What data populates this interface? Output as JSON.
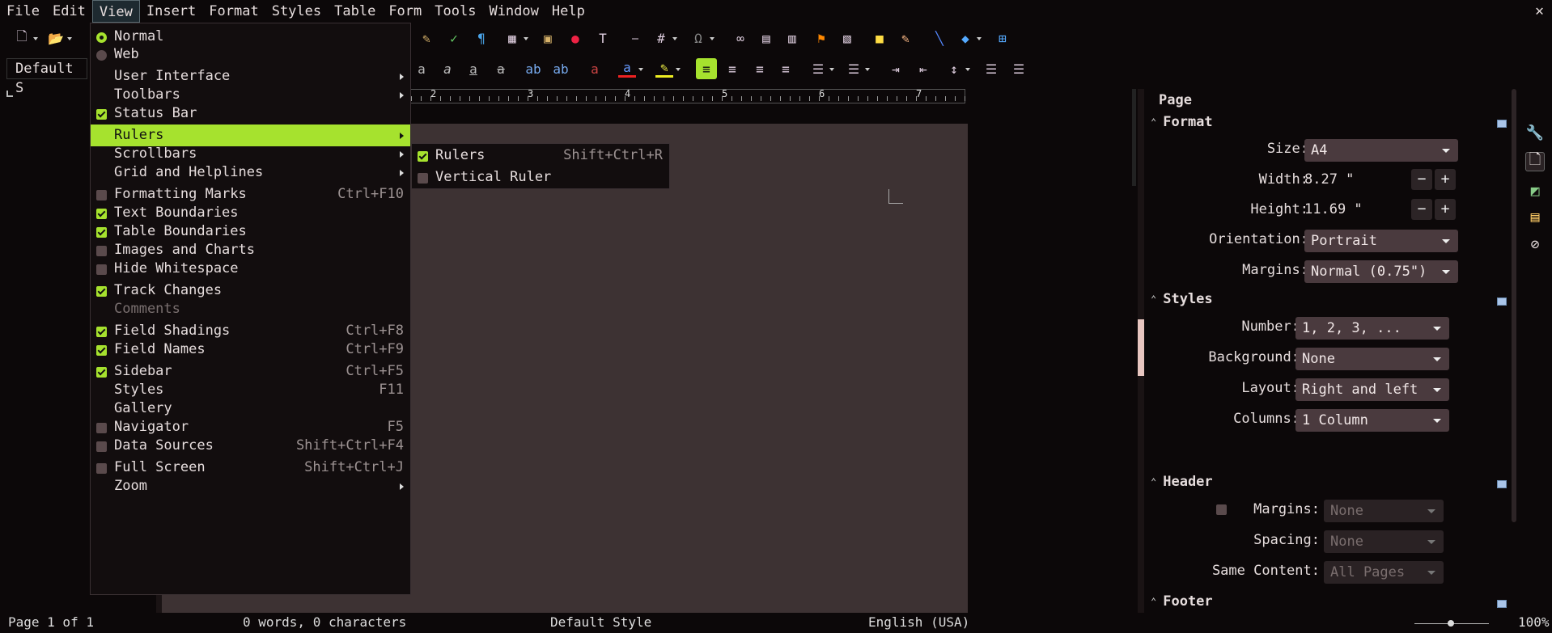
{
  "menubar": {
    "items": [
      "File",
      "Edit",
      "View",
      "Insert",
      "Format",
      "Styles",
      "Table",
      "Form",
      "Tools",
      "Window",
      "Help"
    ],
    "close": "✕"
  },
  "toolbar": {
    "style_value": "Default S"
  },
  "ruler": {
    "numbers": [
      "2",
      "3",
      "4",
      "5",
      "6",
      "7"
    ]
  },
  "view_menu": {
    "items": [
      {
        "label": "Normal",
        "type": "radio",
        "checked": true
      },
      {
        "label": "Web",
        "type": "radio",
        "checked": false
      },
      {
        "label": "User Interface",
        "submenu": true
      },
      {
        "label": "Toolbars",
        "submenu": true
      },
      {
        "label": "Status Bar",
        "type": "check",
        "checked": true
      },
      {
        "label": "Rulers",
        "submenu": true,
        "highlighted": true
      },
      {
        "label": "Scrollbars",
        "submenu": true
      },
      {
        "label": "Grid and Helplines",
        "submenu": true
      },
      {
        "label": "Formatting Marks",
        "type": "check",
        "checked": false,
        "shortcut": "Ctrl+F10"
      },
      {
        "label": "Text Boundaries",
        "type": "check",
        "checked": true
      },
      {
        "label": "Table Boundaries",
        "type": "check",
        "checked": true
      },
      {
        "label": "Images and Charts",
        "type": "check",
        "checked": false
      },
      {
        "label": "Hide Whitespace",
        "type": "check",
        "checked": false
      },
      {
        "label": "Track Changes",
        "type": "check",
        "checked": true
      },
      {
        "label": "Comments",
        "disabled": true
      },
      {
        "label": "Field Shadings",
        "type": "check",
        "checked": true,
        "shortcut": "Ctrl+F8"
      },
      {
        "label": "Field Names",
        "type": "check",
        "checked": true,
        "shortcut": "Ctrl+F9"
      },
      {
        "label": "Sidebar",
        "type": "check",
        "checked": true,
        "shortcut": "Ctrl+F5"
      },
      {
        "label": "Styles",
        "shortcut": "F11"
      },
      {
        "label": "Gallery"
      },
      {
        "label": "Navigator",
        "type": "check",
        "checked": false,
        "shortcut": "F5"
      },
      {
        "label": "Data Sources",
        "type": "check",
        "checked": false,
        "shortcut": "Shift+Ctrl+F4"
      },
      {
        "label": "Full Screen",
        "type": "check",
        "checked": false,
        "shortcut": "Shift+Ctrl+J"
      },
      {
        "label": "Zoom",
        "submenu": true
      }
    ]
  },
  "rulers_submenu": {
    "items": [
      {
        "label": "Rulers",
        "checked": true,
        "shortcut": "Shift+Ctrl+R"
      },
      {
        "label": "Vertical Ruler",
        "checked": false
      }
    ]
  },
  "sidebar": {
    "title": "Page",
    "format": {
      "header": "Format",
      "size_label": "Size:",
      "size_value": "A4",
      "width_label": "Width:",
      "width_value": "8.27 \"",
      "height_label": "Height:",
      "height_value": "11.69 \"",
      "orientation_label": "Orientation:",
      "orientation_value": "Portrait",
      "margins_label": "Margins:",
      "margins_value": "Normal (0.75\")"
    },
    "styles": {
      "header": "Styles",
      "number_label": "Number:",
      "number_value": "1, 2, 3, ...",
      "background_label": "Background:",
      "background_value": "None",
      "layout_label": "Layout:",
      "layout_value": "Right and left",
      "columns_label": "Columns:",
      "columns_value": "1 Column"
    },
    "header_section": {
      "header": "Header",
      "margins_label": "Margins:",
      "margins_value": "None",
      "spacing_label": "Spacing:",
      "spacing_value": "None",
      "same_content_label": "Same Content:",
      "same_content_value": "All Pages"
    },
    "footer_section": {
      "header": "Footer"
    }
  },
  "statusbar": {
    "page": "Page 1 of 1",
    "words": "0 words, 0 characters",
    "style": "Default Style",
    "language": "English (USA)",
    "zoom": "100%"
  },
  "colors": {
    "accent": "#a6e22e",
    "page": "#3d3233",
    "background": "#0c0809"
  }
}
